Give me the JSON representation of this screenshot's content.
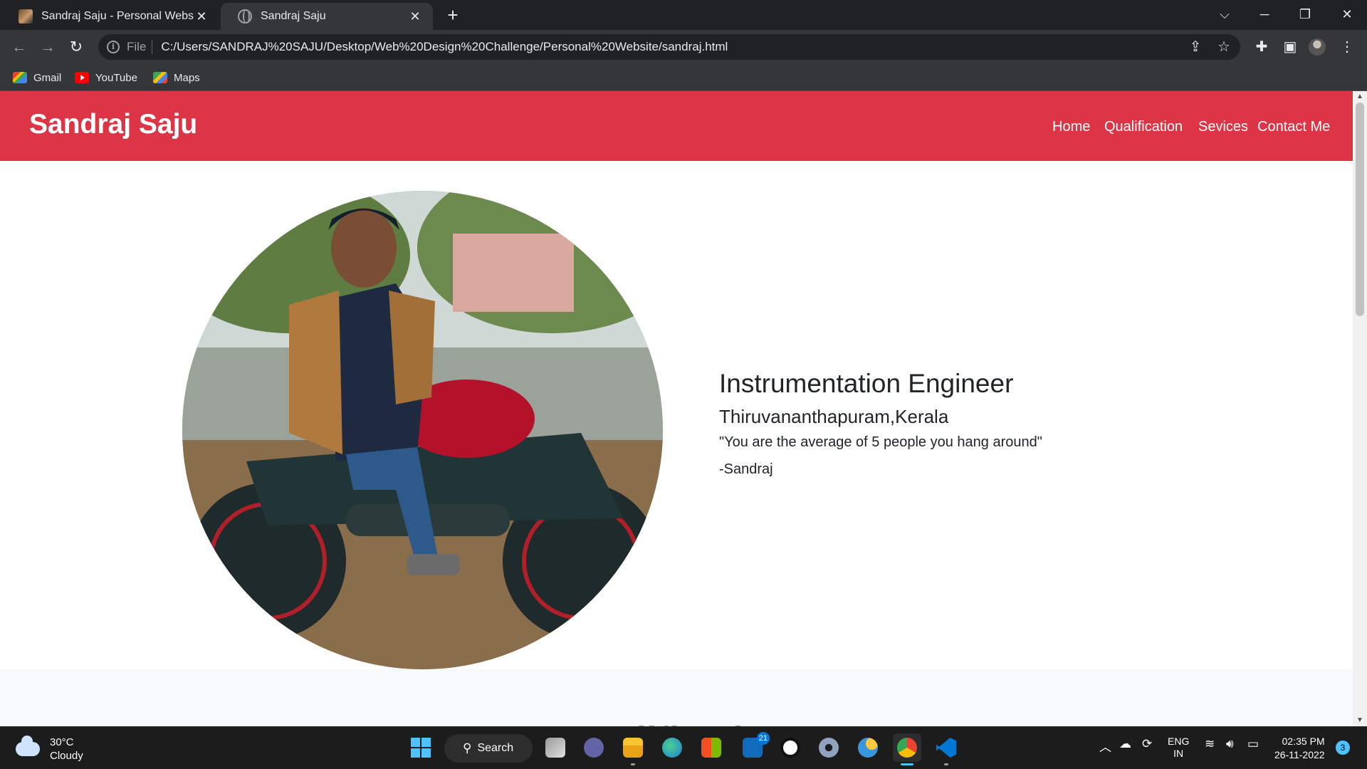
{
  "browser": {
    "tabs": [
      {
        "title": "Sandraj Saju - Personal Website",
        "active": false
      },
      {
        "title": "Sandraj Saju",
        "active": true
      }
    ],
    "scheme_label": "File",
    "url": "C:/Users/SANDRAJ%20SAJU/Desktop/Web%20Design%20Challenge/Personal%20Website/sandraj.html",
    "bookmarks": [
      {
        "label": "Gmail",
        "icon": "gmail-icon"
      },
      {
        "label": "YouTube",
        "icon": "youtube-icon"
      },
      {
        "label": "Maps",
        "icon": "maps-icon"
      }
    ]
  },
  "site": {
    "brand": "Sandraj Saju",
    "nav": [
      "Home",
      "Qualification",
      "Sevices",
      "Contact Me"
    ],
    "hero": {
      "role": "Instrumentation Engineer",
      "location": "Thiruvananthapuram,Kerala",
      "quote": "\"You are the average of 5 people you hang around\"",
      "author": "-Sandraj"
    },
    "next_section_title": "Qualification",
    "accent_color": "#dc3545"
  },
  "taskbar": {
    "weather": {
      "temp": "30°C",
      "condition": "Cloudy"
    },
    "search_label": "Search",
    "mail_badge": "21",
    "language": {
      "line1": "ENG",
      "line2": "IN"
    },
    "time": "02:35 PM",
    "date": "26-11-2022",
    "notification_count": "3"
  }
}
